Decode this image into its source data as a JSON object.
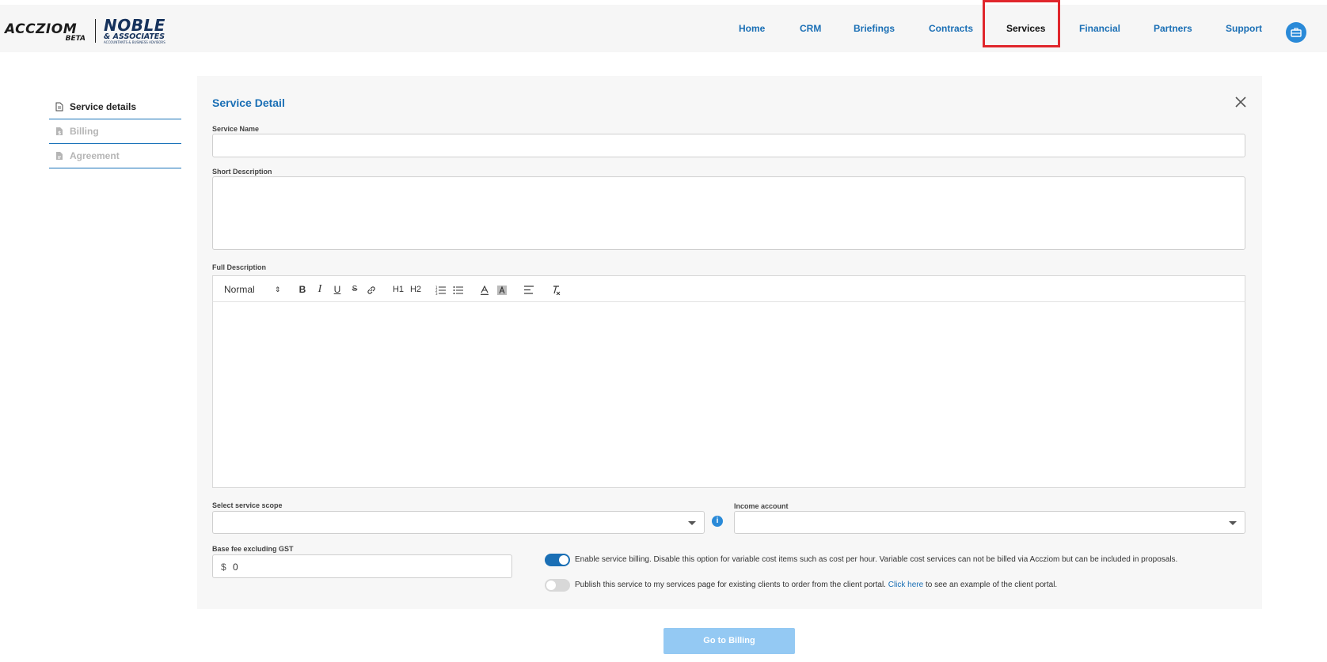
{
  "header": {
    "logo": {
      "brand": "ACCZIOM",
      "beta": "BETA",
      "partner_line1": "NOBLE",
      "partner_line2": "& ASSOCIATES",
      "partner_tagline": "ACCOUNTANTS & BUSINESS ADVISORS"
    },
    "nav": [
      {
        "label": "Home"
      },
      {
        "label": "CRM"
      },
      {
        "label": "Briefings"
      },
      {
        "label": "Contracts"
      },
      {
        "label": "Services",
        "active": true
      },
      {
        "label": "Financial"
      },
      {
        "label": "Partners"
      },
      {
        "label": "Support"
      }
    ],
    "user_icon": "briefcase-icon"
  },
  "sidebar": {
    "items": [
      {
        "label": "Service details",
        "state": "active"
      },
      {
        "label": "Billing",
        "state": "disabled"
      },
      {
        "label": "Agreement",
        "state": "disabled"
      }
    ]
  },
  "form": {
    "title": "Service Detail",
    "service_name": {
      "label": "Service Name",
      "value": ""
    },
    "short_description": {
      "label": "Short Description",
      "value": ""
    },
    "full_description": {
      "label": "Full Description",
      "toolbar": {
        "heading_select": "Normal",
        "bold": "B",
        "italic": "I",
        "underline": "U",
        "strike": "S",
        "h1": "H1",
        "h2": "H2"
      },
      "value": ""
    },
    "service_scope": {
      "label": "Select service scope",
      "value": ""
    },
    "income_account": {
      "label": "Income account",
      "value": ""
    },
    "base_fee": {
      "label": "Base fee excluding GST",
      "currency": "$",
      "value": "0"
    },
    "billing_toggle": {
      "on": true,
      "text": "Enable service billing. Disable this option for variable cost items such as cost per hour. Variable cost services can not be billed via Accziom but can be included in proposals."
    },
    "publish_toggle": {
      "on": false,
      "text_before": "Publish this service to my services page for existing clients to order from the client portal.",
      "link": "Click here",
      "text_after": "to see an example of the client portal."
    }
  },
  "go_button": {
    "label": "Go to Billing"
  },
  "colors": {
    "accent": "#1a6fb5",
    "highlight": "#e0262c",
    "button_disabled": "#94c9f3"
  }
}
